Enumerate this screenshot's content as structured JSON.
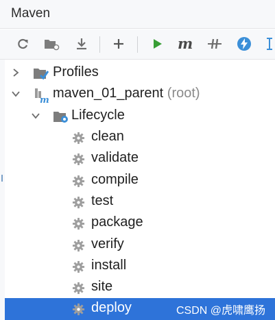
{
  "window": {
    "title": "Maven"
  },
  "toolbar": {
    "buttons": [
      {
        "icon": "reload-icon"
      },
      {
        "icon": "folder-sources-icon"
      },
      {
        "icon": "download-icon"
      },
      {
        "icon": "add-icon"
      },
      {
        "icon": "run-icon"
      },
      {
        "icon": "maven-goal-icon"
      },
      {
        "icon": "skip-tests-icon"
      },
      {
        "icon": "offline-lightning-icon"
      },
      {
        "icon": "collapse-icon"
      }
    ],
    "run_color": "#389e35",
    "lightning_color": "#3b8fd8"
  },
  "tree": {
    "profiles": {
      "label": "Profiles"
    },
    "project": {
      "label": "maven_01_parent",
      "note": "(root)"
    },
    "lifecycle": {
      "label": "Lifecycle"
    },
    "phases": [
      "clean",
      "validate",
      "compile",
      "test",
      "package",
      "verify",
      "install",
      "site",
      "deploy"
    ],
    "selected": "deploy",
    "selection_color": "#2e73d9"
  },
  "watermark": "CSDN @虎啸鹰扬"
}
